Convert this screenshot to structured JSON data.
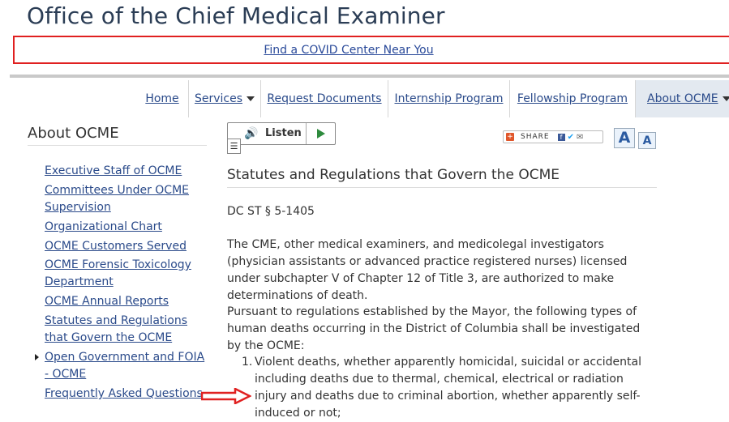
{
  "header": {
    "site_title": "Office of the Chief Medical Examiner",
    "alert_link": "Find a COVID Center Near You"
  },
  "nav": {
    "items": [
      {
        "label": "Home"
      },
      {
        "label": "Services"
      },
      {
        "label": "Request Documents"
      },
      {
        "label": "Internship Program"
      },
      {
        "label": "Fellowship Program"
      },
      {
        "label": "About OCME"
      }
    ]
  },
  "sidebar": {
    "title": "About OCME",
    "links": [
      {
        "label": "Executive Staff of OCME"
      },
      {
        "label": "Committees Under OCME Supervision"
      },
      {
        "label": "Organizational Chart"
      },
      {
        "label": "OCME Customers Served"
      },
      {
        "label": "OCME Forensic Toxicology Department"
      },
      {
        "label": "OCME Annual Reports"
      },
      {
        "label": "Statutes and Regulations that Govern the OCME"
      },
      {
        "label": "Open Government and FOIA - OCME"
      },
      {
        "label": "Frequently Asked Questions"
      }
    ]
  },
  "toolbar": {
    "listen_label": "Listen",
    "share_label": "SHARE",
    "font_large": "A",
    "font_small": "A"
  },
  "content": {
    "title": "Statutes and Regulations that Govern the OCME",
    "citation": "DC ST § 5-1405",
    "para1": "The CME, other medical examiners, and medicolegal investigators (physician assistants or advanced practice registered nurses) licensed under subchapter V of Chapter 12 of Title 3, are authorized to make determinations of death.",
    "para2": "Pursuant to regulations established by the Mayor, the following types of human deaths occurring in the District of Columbia shall be investigated by the OCME:",
    "list": [
      {
        "num": "1.",
        "text": "Violent deaths, whether apparently homicidal, suicidal or accidental including deaths due to thermal, chemical, electrical or radiation injury and deaths due to criminal abortion, whether apparently self-induced or not;"
      }
    ]
  },
  "colors": {
    "accent_red": "#e02020",
    "link_blue": "#2a4a8a",
    "active_nav_bg": "#e3e9f0"
  }
}
